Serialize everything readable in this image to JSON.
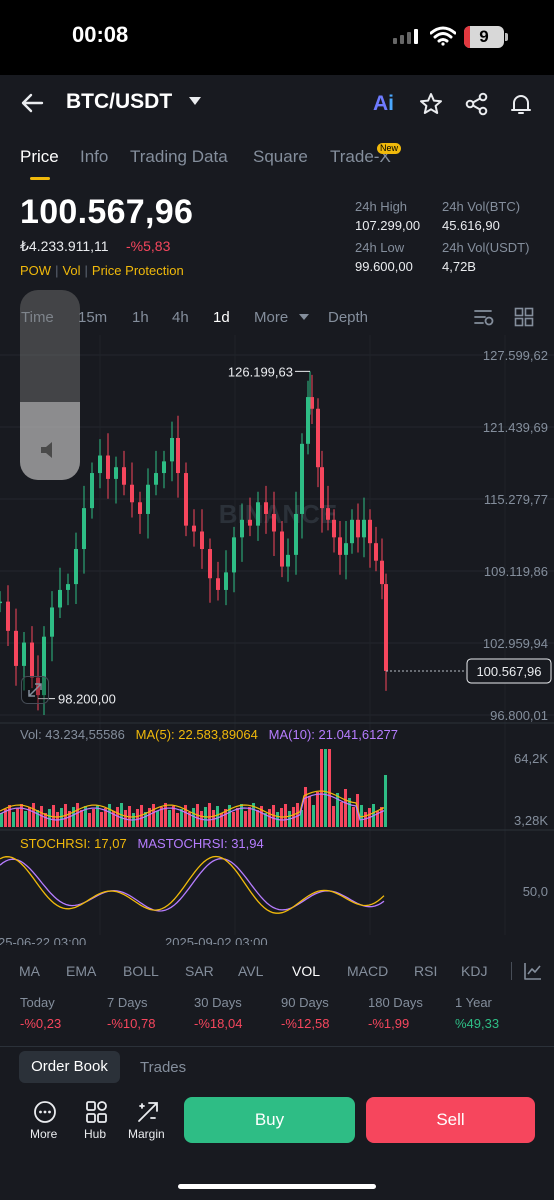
{
  "status_bar": {
    "time": "00:08",
    "battery": "9"
  },
  "header": {
    "pair": "BTC/USDT",
    "ai_label_a": "A",
    "ai_label_i": "i"
  },
  "tabs": [
    {
      "label": "Price"
    },
    {
      "label": "Info"
    },
    {
      "label": "Trading Data"
    },
    {
      "label": "Square"
    },
    {
      "label": "Trade-X"
    }
  ],
  "new_badge": "New",
  "price": {
    "last": "100.567,96",
    "fiat": "₺4.233.911,11",
    "change": "-%5,83",
    "tags": [
      "POW",
      "Vol",
      "Price Protection"
    ]
  },
  "stats": {
    "high_label": "24h High",
    "high": "107.299,00",
    "low_label": "24h Low",
    "low": "99.600,00",
    "vol_btc_label": "24h Vol(BTC)",
    "vol_btc": "45.616,90",
    "vol_usdt_label": "24h Vol(USDT)",
    "vol_usdt": "4,72B"
  },
  "timeframes": [
    "Time",
    "15m",
    "1h",
    "4h",
    "1d",
    "More",
    "Depth"
  ],
  "active_timeframe": "1d",
  "chart_data": {
    "type": "candlestick",
    "y_axis": [
      "127.599,62",
      "121.439,69",
      "115.279,77",
      "109.119,86",
      "102.959,94",
      "96.800,01"
    ],
    "ylim": [
      96800.01,
      127599.62
    ],
    "max_label": "126.199,63",
    "min_label": "98.200,00",
    "current_price": "100.567,96",
    "watermark": "BINANCE",
    "x_labels": [
      "25-06-22 03:00",
      "2025-09-02 03:00"
    ],
    "volume": {
      "label": "Vol: 43.234,55586",
      "ma5": "MA(5): 22.583,89064",
      "ma10": "MA(10): 21.041,61277",
      "y_axis": [
        "64,2K",
        "3,28K"
      ]
    },
    "stochrsi": {
      "label": "STOCHRSI: 17,07",
      "ma_label": "MASTOCHRSI: 31,94",
      "y_axis": [
        "50,0"
      ]
    }
  },
  "indicators": [
    "MA",
    "EMA",
    "BOLL",
    "SAR",
    "AVL",
    "VOL",
    "MACD",
    "RSI",
    "KDJ"
  ],
  "active_indicator": "VOL",
  "performance": [
    {
      "label": "Today",
      "value": "-%0,23",
      "dir": "down"
    },
    {
      "label": "7 Days",
      "value": "-%10,78",
      "dir": "down"
    },
    {
      "label": "30 Days",
      "value": "-%18,04",
      "dir": "down"
    },
    {
      "label": "90 Days",
      "value": "-%12,58",
      "dir": "down"
    },
    {
      "label": "180 Days",
      "value": "-%1,99",
      "dir": "down"
    },
    {
      "label": "1 Year",
      "value": "%49,33",
      "dir": "up"
    }
  ],
  "book_tabs": {
    "order_book": "Order Book",
    "trades": "Trades"
  },
  "bottom_bar": {
    "more": "More",
    "hub": "Hub",
    "margin": "Margin",
    "buy": "Buy",
    "sell": "Sell"
  },
  "colors": {
    "up": "#2ebd85",
    "down": "#f6465d",
    "accent": "#f0b90b",
    "ma10": "#b67dff"
  }
}
